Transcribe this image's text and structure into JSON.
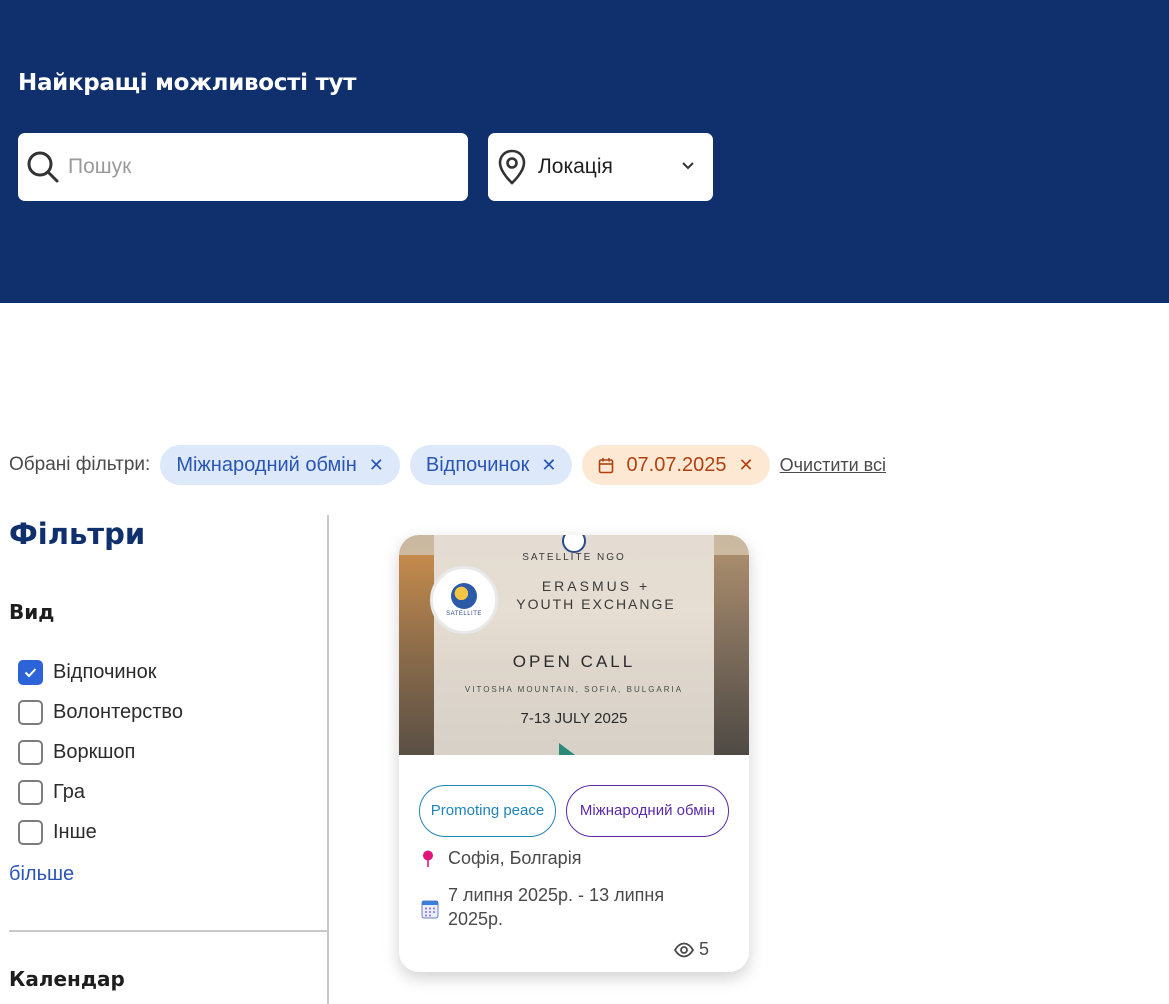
{
  "hero": {
    "title": "Найкращі можливості тут",
    "search_placeholder": "Пошук",
    "location_label": "Локація"
  },
  "selected_filters": {
    "label": "Обрані фільтри:",
    "chips": [
      "Міжнародний обмін",
      "Відпочинок",
      "07.07.2025"
    ],
    "clear_all": "Очистити всі"
  },
  "sidebar": {
    "title": "Фільтри",
    "type_heading": "Вид",
    "types": [
      {
        "label": "Відпочинок",
        "checked": true
      },
      {
        "label": "Волонтерство",
        "checked": false
      },
      {
        "label": "Воркшоп",
        "checked": false
      },
      {
        "label": "Гра",
        "checked": false
      },
      {
        "label": "Інше",
        "checked": false
      }
    ],
    "more": "більше",
    "calendar_heading": "Календар"
  },
  "card": {
    "image": {
      "org": "SATELLITE NGO",
      "logo_text": "SATELLITE",
      "line1": "ERASMUS +",
      "line2": "YOUTH EXCHANGE",
      "line3": "OPEN CALL",
      "line4": "VITOSHA MOUNTAIN, SOFIA, BULGARIA",
      "line5": "7-13 JULY 2025"
    },
    "tags": [
      "Promoting peace",
      "Міжнародний обмін"
    ],
    "location": "Софія, Болгарія",
    "dates": "7 липня 2025р. - 13 липня 2025р.",
    "views": "5"
  },
  "colors": {
    "hero_bg": "#0f2f6d",
    "chip_blue_bg": "#dde9fb",
    "chip_orange_bg": "#fde9d3",
    "checkbox_checked": "#2c63d8",
    "tag_blue": "#1f84b8",
    "tag_purple": "#5a2aa8"
  }
}
